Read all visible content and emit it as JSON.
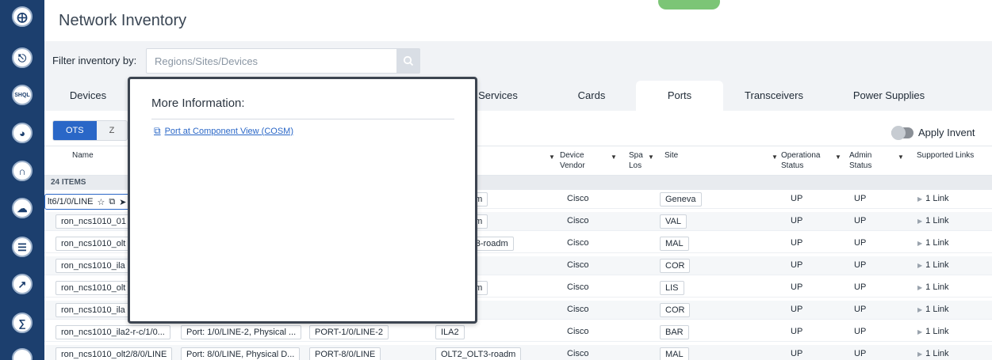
{
  "header": {
    "title": "Network Inventory"
  },
  "rail": {
    "items": [
      {
        "icon": "globe-icon",
        "label": ""
      },
      {
        "icon": "cisco-logo-icon",
        "label": ""
      },
      {
        "icon": "shql-icon",
        "label": "SHQL"
      },
      {
        "icon": "radar-icon",
        "label": ""
      },
      {
        "icon": "magnet-icon",
        "label": ""
      },
      {
        "icon": "cloud-icon",
        "label": ""
      },
      {
        "icon": "layers-icon",
        "label": ""
      },
      {
        "icon": "trend-icon",
        "label": ""
      },
      {
        "icon": "document-icon",
        "label": ""
      }
    ]
  },
  "filter": {
    "label": "Filter inventory by:",
    "placeholder": "Regions/Sites/Devices"
  },
  "tabs": [
    "Devices",
    "Services",
    "Cards",
    "Ports",
    "Transceivers",
    "Power Supplies"
  ],
  "active_tab": "Ports",
  "subtabs": [
    "OTS",
    "Z"
  ],
  "apply_label": "Apply Invent",
  "table": {
    "columns": {
      "name": "Name",
      "device_vendor": "Device\nVendor",
      "spa_los": "Spa\nLos",
      "site": "Site",
      "operational_status": "Operationa\nStatus",
      "admin_status": "Admin\nStatus",
      "supported_links": "Supported Links"
    },
    "items_count": "24 ITEMS",
    "rows": [
      {
        "name": "",
        "description": "",
        "port": "",
        "device": "dm",
        "vendor": "Cisco",
        "site": "Geneva",
        "oper": "UP",
        "admin": "UP",
        "links": "1 Link"
      },
      {
        "name": "ron_ncs1010_01",
        "description": "",
        "port": "",
        "device": "dm",
        "vendor": "Cisco",
        "site": "VAL",
        "oper": "UP",
        "admin": "UP",
        "links": "1 Link"
      },
      {
        "name": "ron_ncs1010_olt",
        "description": "",
        "port": "",
        "device": "T3-roadm",
        "vendor": "Cisco",
        "site": "MAL",
        "oper": "UP",
        "admin": "UP",
        "links": "1 Link"
      },
      {
        "name": "ron_ncs1010_ila",
        "description": "",
        "port": "",
        "device": "",
        "vendor": "Cisco",
        "site": "COR",
        "oper": "UP",
        "admin": "UP",
        "links": "1 Link"
      },
      {
        "name": "ron_ncs1010_olt",
        "description": "",
        "port": "",
        "device": "dm",
        "vendor": "Cisco",
        "site": "LIS",
        "oper": "UP",
        "admin": "UP",
        "links": "1 Link"
      },
      {
        "name": "ron_ncs1010_ila",
        "description": "",
        "port": "",
        "device": "",
        "vendor": "Cisco",
        "site": "COR",
        "oper": "UP",
        "admin": "UP",
        "links": "1 Link"
      },
      {
        "name": "ron_ncs1010_ila2-r-c/1/0...",
        "description": "Port: 1/0/LINE-2, Physical ...",
        "port": "PORT-1/0/LINE-2",
        "device": "ILA2",
        "vendor": "Cisco",
        "site": "BAR",
        "oper": "UP",
        "admin": "UP",
        "links": "1 Link"
      },
      {
        "name": "ron_ncs1010_olt2/8/0/LINE",
        "description": "Port: 8/0/LINE, Physical D...",
        "port": "PORT-8/0/LINE",
        "device": "OLT2_OLT3-roadm",
        "vendor": "Cisco",
        "site": "MAL",
        "oper": "UP",
        "admin": "UP",
        "links": "1 Link"
      }
    ]
  },
  "hover_toolbar": {
    "label": "lt6/1/0/LINE"
  },
  "popover": {
    "title": "More Information:",
    "link_text": "Port at Component View (COSM)"
  }
}
